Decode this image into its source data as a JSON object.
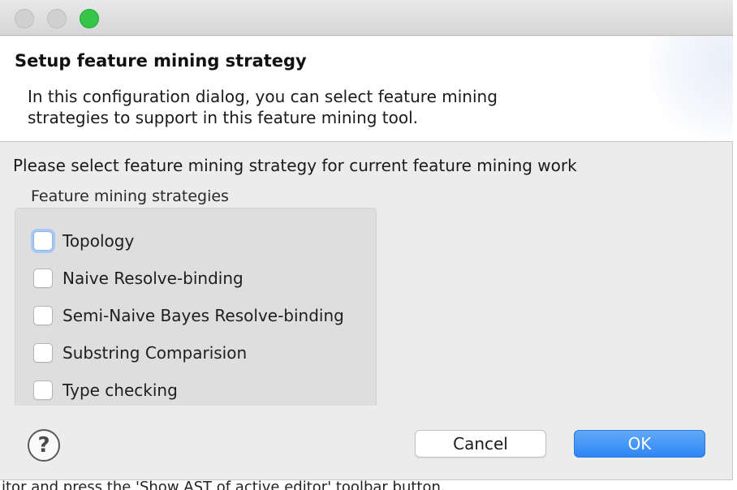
{
  "window": {
    "buttons": [
      "close",
      "minimize",
      "zoom"
    ]
  },
  "header": {
    "title": "Setup feature mining strategy",
    "description_line1": "In this configuration dialog, you can select feature mining",
    "description_line2": "strategies to support in this feature mining tool."
  },
  "prompt": "Please select feature mining strategy for current feature mining work",
  "group": {
    "label": "Feature mining strategies",
    "options": [
      {
        "label": "Topology",
        "checked": false,
        "focused": true
      },
      {
        "label": "Naive Resolve-binding",
        "checked": false
      },
      {
        "label": "Semi-Naive Bayes Resolve-binding",
        "checked": false
      },
      {
        "label": "Substring Comparision",
        "checked": false
      },
      {
        "label": "Type checking",
        "checked": false
      }
    ]
  },
  "footer": {
    "help_glyph": "?",
    "cancel_label": "Cancel",
    "ok_label": "OK"
  },
  "background": {
    "bottom_text": "itor and press the 'Show AST of active editor' toolbar button."
  },
  "colors": {
    "ok_button": "#3b8ff6",
    "focus_ring": "#a9c8f3",
    "zoom_light": "#35c649"
  }
}
